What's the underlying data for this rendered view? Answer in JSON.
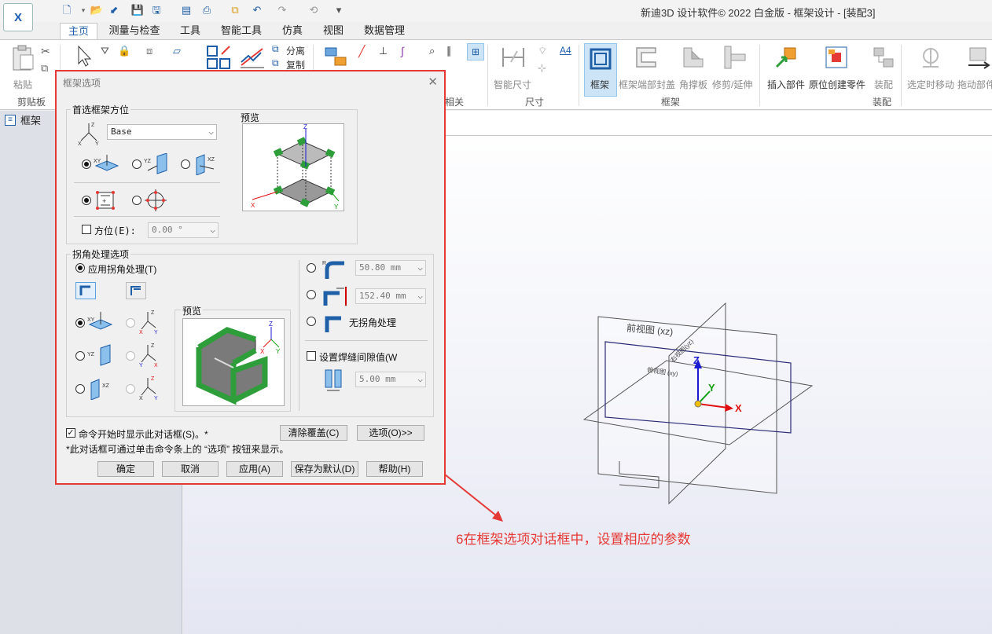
{
  "app": {
    "logo_text": "X",
    "window_title": "新迪3D 设计软件© 2022 白金版 - 框架设计 - [装配3]"
  },
  "tabs": [
    "主页",
    "测量与检查",
    "工具",
    "智能工具",
    "仿真",
    "视图",
    "数据管理"
  ],
  "ribbon": {
    "paste_label": "粘贴",
    "clipboard_group": "剪贴板",
    "separate_label": "分离",
    "copy_label": "复制",
    "related_group": "相关",
    "smart_dim_label": "智能尺寸",
    "dim_group": "尺寸",
    "frame_label": "框架",
    "frame_end_cap_label": "框架端部封盖",
    "gusset_label": "角撑板",
    "trim_extend_label": "修剪/延伸",
    "frame_group": "框架",
    "insert_part_label": "插入部件",
    "create_in_place_label": "原位创建零件",
    "assemble_label": "装配",
    "assembly_group": "装配",
    "move_selected_label": "选定时移动",
    "drag_part_label": "拖动部件"
  },
  "tree": {
    "root_label": "框架"
  },
  "dialog": {
    "title": "框架选项",
    "orientation": {
      "group_label": "首选框架方位",
      "plane_select": "Base",
      "xy_label": "XY",
      "yz_label": "YZ",
      "xz_label": "XZ",
      "angle_label": "方位(E):",
      "angle_value": "0.00 °",
      "preview_label": "预览"
    },
    "corner": {
      "group_label": "拐角处理选项",
      "apply_label": "应用拐角处理(T)",
      "preview_label": "预览",
      "value1": "50.80 mm",
      "value2": "152.40 mm",
      "no_corner_label": "无拐角处理",
      "weld_gap_label": "设置焊缝间隙值(W",
      "weld_gap_value": "5.00 mm"
    },
    "show_on_start_label": "命令开始时显示此对话框(S)。*",
    "clear_override_label": "清除覆盖(C)",
    "options_label": "选项(O)>>",
    "footnote": "*此对话框可通过单击命令条上的 “选项” 按钮来显示。",
    "ok_label": "确定",
    "cancel_label": "取消",
    "apply_label": "应用(A)",
    "save_default_label": "保存为默认(D)",
    "help_label": "帮助(H)"
  },
  "viewport": {
    "front_view_label": "前视图 (xz)",
    "right_view_label": "右视图(yz)",
    "top_view_label": "俯视图 (xy)",
    "axis_x": "X",
    "axis_y": "Y",
    "axis_z": "Z"
  },
  "annotation": "6在框架选项对话框中，设置相应的参数",
  "colors": {
    "accent": "#1f5fa8",
    "annotation_red": "#e53935",
    "frame_green": "#2e9e3a"
  }
}
